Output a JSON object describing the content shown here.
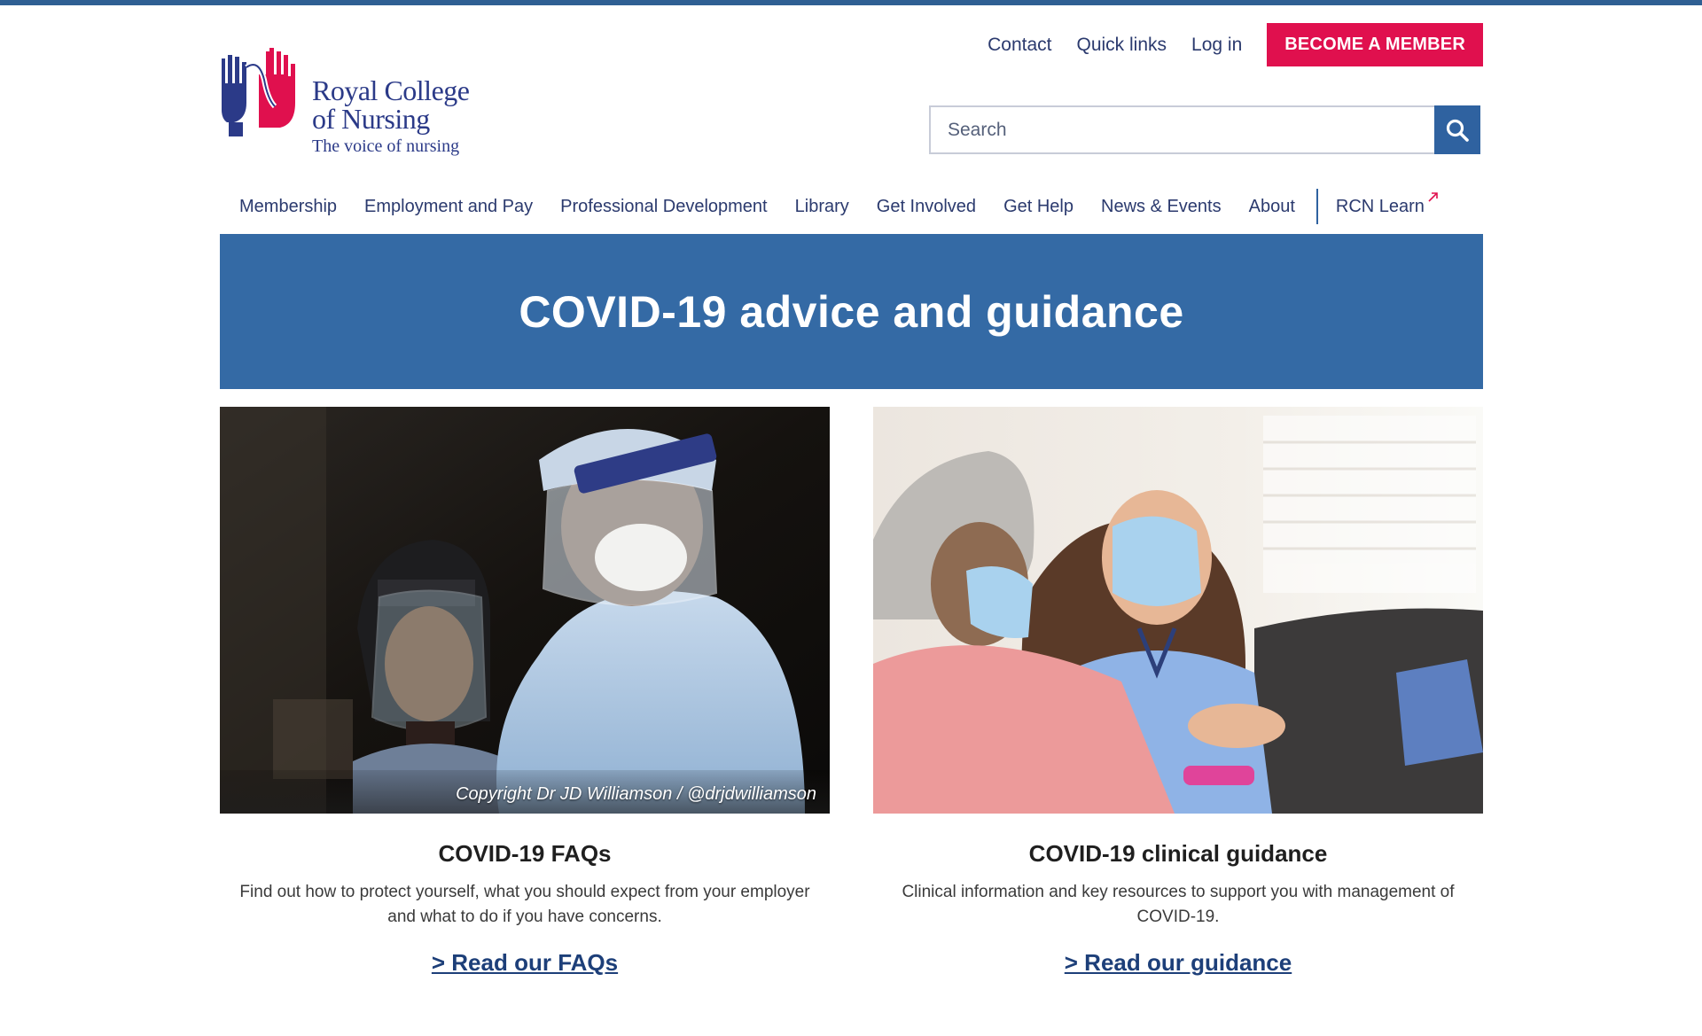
{
  "brand": {
    "name_line1": "Royal College",
    "name_line2": "of Nursing",
    "tagline": "The voice of nursing",
    "colors": {
      "blue": "#2b3a88",
      "red": "#e0104e",
      "accent": "#2f62a0",
      "banner": "#346aa5"
    }
  },
  "utility": {
    "contact": "Contact",
    "quick_links": "Quick links",
    "login": "Log in",
    "member_button": "BECOME A MEMBER"
  },
  "search": {
    "placeholder": "Search",
    "value": "",
    "icon": "search-icon"
  },
  "nav": {
    "items": [
      "Membership",
      "Employment and Pay",
      "Professional Development",
      "Library",
      "Get Involved",
      "Get Help",
      "News & Events",
      "About"
    ],
    "external": "RCN Learn",
    "external_icon": "external-link-icon"
  },
  "banner": {
    "title": "COVID-19 advice and guidance"
  },
  "cards": [
    {
      "title": "COVID-19 FAQs",
      "description": "Find out how to protect yourself, what you should expect from your employer and what to do if you have concerns.",
      "link": "> Read our FAQs",
      "image_caption": "Copyright Dr JD Williamson / @drjdwilliamson"
    },
    {
      "title": "COVID-19 clinical guidance",
      "description": "Clinical information and key resources to support you with management of COVID-19.",
      "link": "> Read our guidance"
    }
  ]
}
